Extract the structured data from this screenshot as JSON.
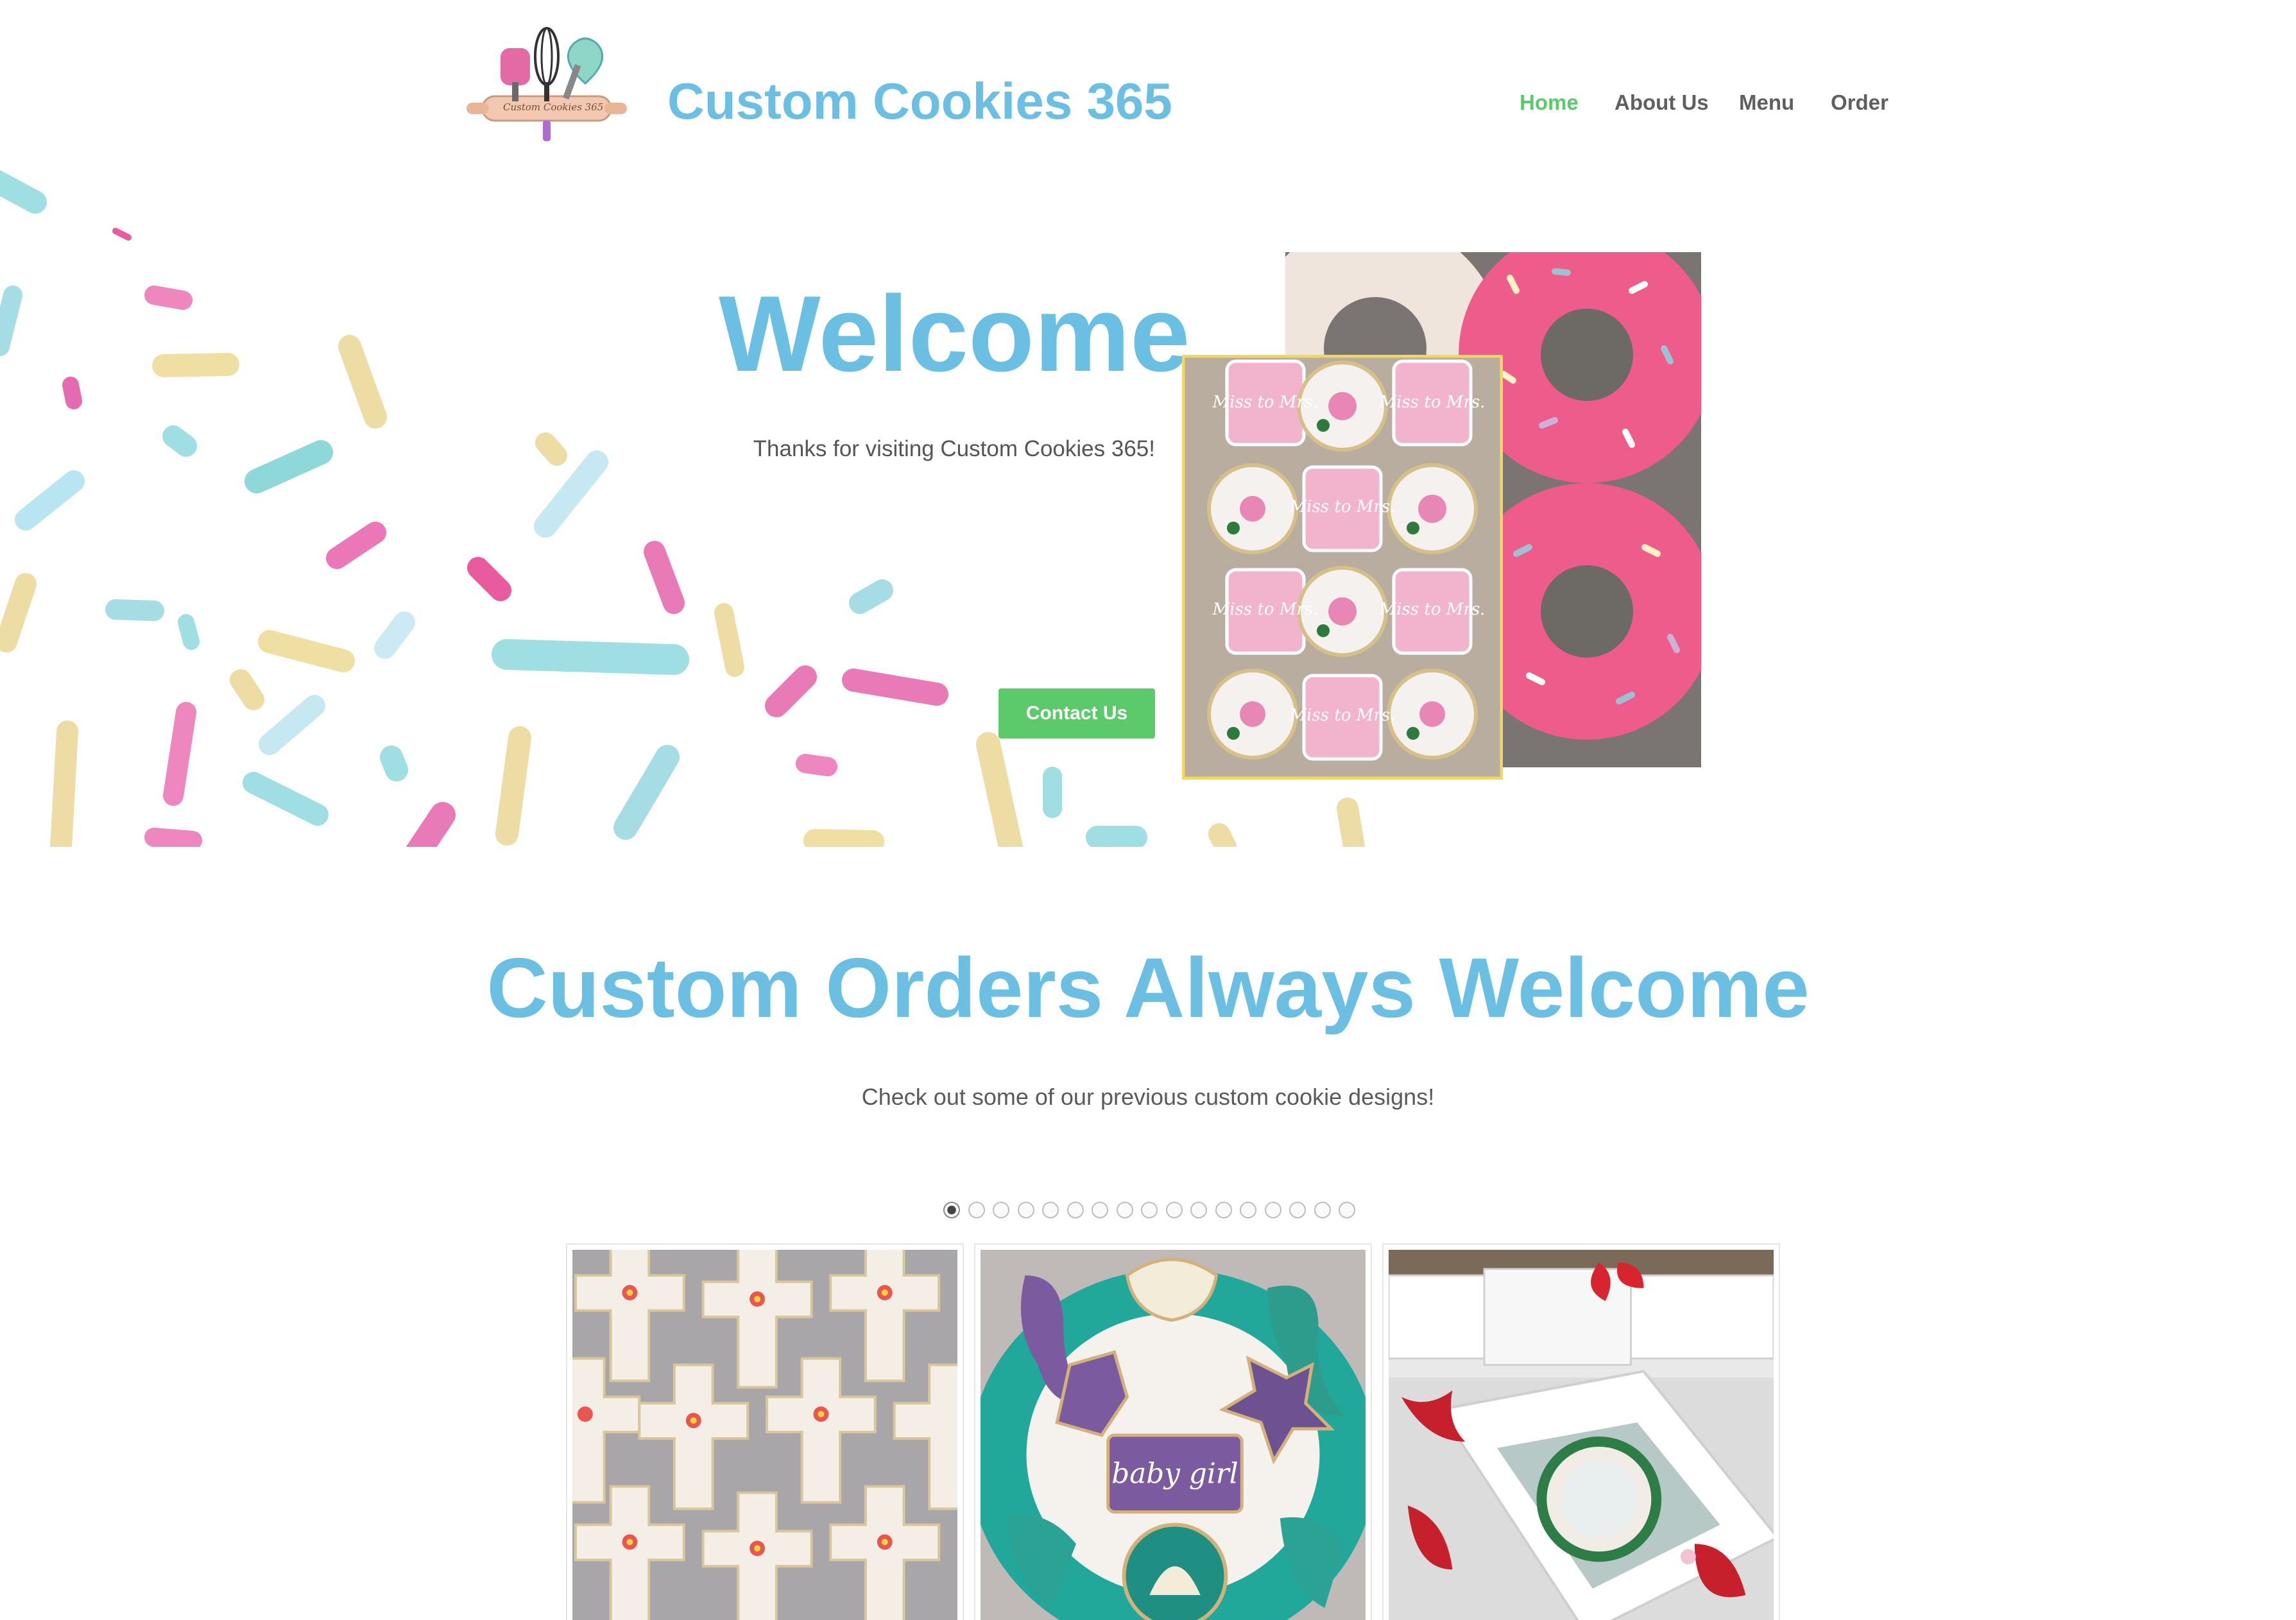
{
  "header": {
    "logo_text": "Custom Cookies 365",
    "site_title": "Custom Cookies 365",
    "nav": [
      {
        "label": "Home",
        "active": true
      },
      {
        "label": "About Us",
        "active": false
      },
      {
        "label": "Menu",
        "active": false
      },
      {
        "label": "Order",
        "active": false
      }
    ]
  },
  "hero": {
    "heading": "Welcome",
    "subtext": "Thanks for visiting Custom Cookies 365!",
    "cta_label": "Contact Us",
    "cookie_text": "Miss to Mrs."
  },
  "orders": {
    "heading": "Custom Orders Always Welcome",
    "subtext": "Check out some of our previous custom cookie designs!",
    "slide_count": 17,
    "active_slide": 1,
    "gallery": [
      {
        "icon": "cross-cookies-photo"
      },
      {
        "icon": "mermaid-cookies-photo",
        "text": "baby girl"
      },
      {
        "icon": "gift-box-cookies-photo"
      }
    ]
  },
  "colors": {
    "accent_blue": "#6bbfe2",
    "accent_green": "#5cc96b",
    "nav_text": "#5f5f5f",
    "body_text": "#555555"
  }
}
